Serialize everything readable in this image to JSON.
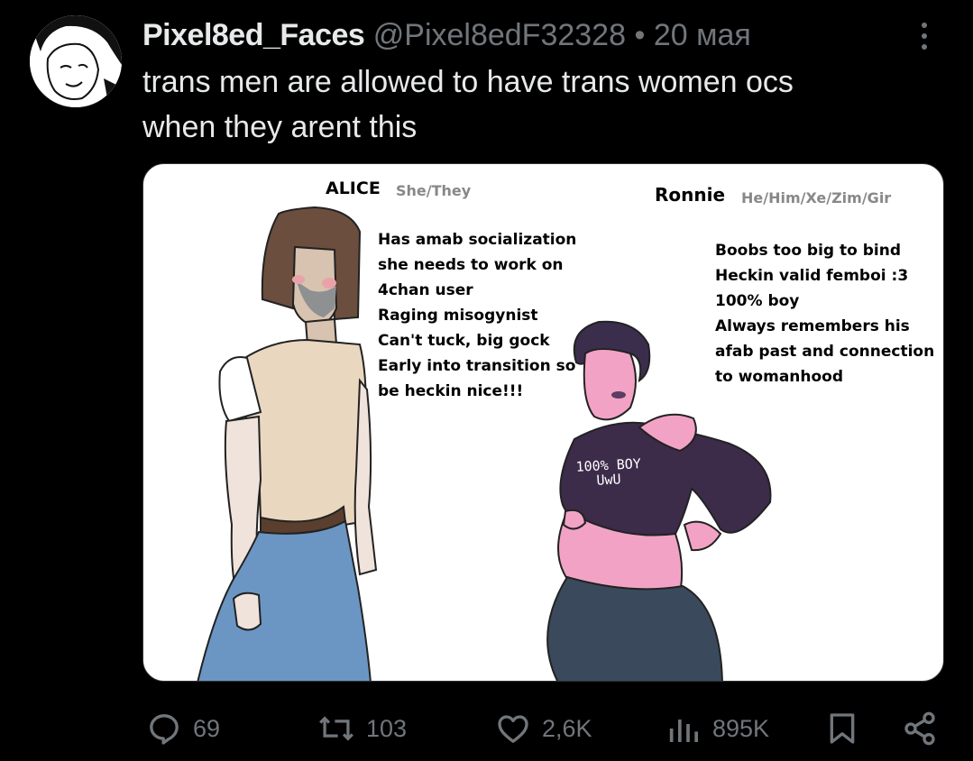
{
  "post": {
    "display_name": "Pixel8ed_Faces",
    "handle": "@Pixel8edF32328",
    "separator": "•",
    "date": "20 мая",
    "text_line1": "trans men are allowed to have trans women ocs",
    "text_line2": "when they arent this"
  },
  "image": {
    "left_name": "ALICE",
    "left_pronouns": "She/They",
    "left_traits": [
      "Has amab socialization",
      "she needs to work on",
      "4chan user",
      "Raging misogynist",
      "Can't tuck, big gock",
      "Early into transition so",
      "be heckin nice!!!"
    ],
    "right_name": "Ronnie",
    "right_pronouns": "He/Him/Xe/Zim/Gir",
    "right_traits": [
      "Boobs too big to bind",
      "Heckin valid femboi :3",
      "100% boy",
      "Always remembers his",
      "afab past and connection",
      "to womanhood"
    ],
    "shirt_line1": "100% BOY",
    "shirt_line2": "UwU"
  },
  "actions": {
    "replies": "69",
    "reposts": "103",
    "likes": "2,6K",
    "views": "895K"
  },
  "icons": [
    "avatar",
    "more-icon",
    "reply-icon",
    "repost-icon",
    "like-icon",
    "views-icon",
    "bookmark-icon",
    "share-icon"
  ]
}
